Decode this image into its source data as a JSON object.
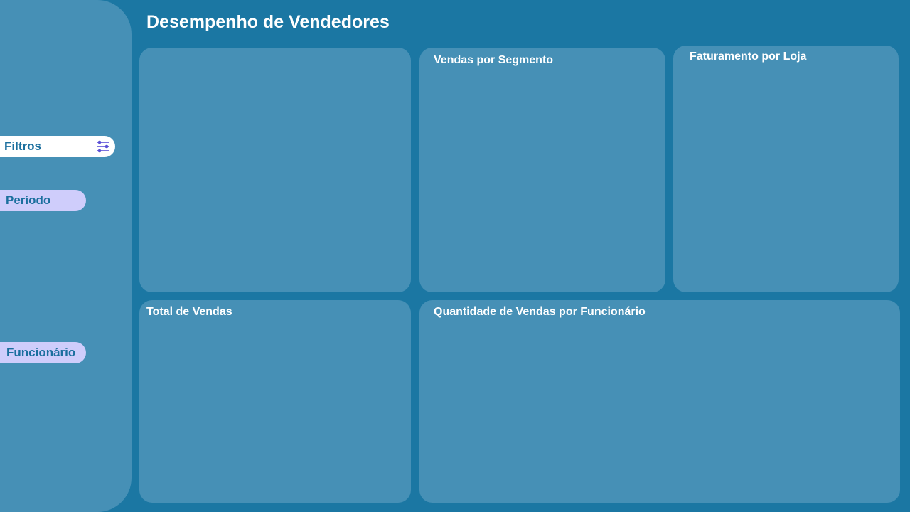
{
  "page": {
    "title": "Desempenho de Vendedores"
  },
  "sidebar": {
    "filters_label": "Filtros",
    "filters_icon": "sliders-icon",
    "periodo_label": "Período",
    "funcionario_label": "Funcionário"
  },
  "cards": {
    "segmento_title": "Vendas por Segmento",
    "loja_title": "Faturamento por Loja",
    "total_title": "Total de Vendas",
    "funcionario_title": "Quantidade de Vendas por Funcionário"
  },
  "colors": {
    "background": "#1b77a3",
    "panel": "#4690b6",
    "accent_text": "#1b6f9e",
    "pill_soft": "#cfcdfb",
    "filter_icon": "#5a4fd6"
  }
}
